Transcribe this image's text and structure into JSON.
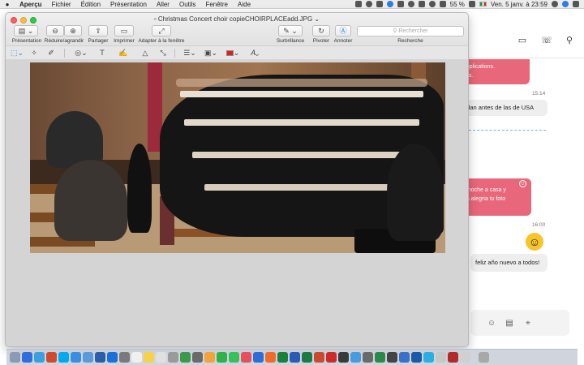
{
  "menubar": {
    "apple": "",
    "app_name": "Aperçu",
    "menus": [
      "Fichier",
      "Édition",
      "Présentation",
      "Aller",
      "Outils",
      "Fenêtre",
      "Aide"
    ],
    "battery": "55 %",
    "datetime": "Ven. 5 janv. à  23:59"
  },
  "window": {
    "title": "Christmas Concert choir copieCHOIRPLACEadd.JPG",
    "toolbar": {
      "presentation": "Présentation",
      "zoom": "Réduire/agrandir",
      "share": "Partager",
      "print": "Imprimer",
      "fit": "Adapter à la fenêtre",
      "highlight": "Surbrillance",
      "rotate": "Pivoter",
      "annotate": "Annoter",
      "search_placeholder": "Rechercher",
      "search_label": "Recherche"
    }
  },
  "chat": {
    "msg1_line1": "applications.",
    "msg1_line2": "ero.",
    "time1": "15:14",
    "msg2": "ndan antes de las de USA",
    "msg3_line1": "a noche a casa y",
    "msg3_line2": "na alegria tu foto",
    "time2": "16:00",
    "msg4": "feliz año nuevo a todos!"
  },
  "colors": {
    "accent_blue": "#2f7de1",
    "chat_pink": "#e8677a",
    "markup_red": "#e02020"
  }
}
